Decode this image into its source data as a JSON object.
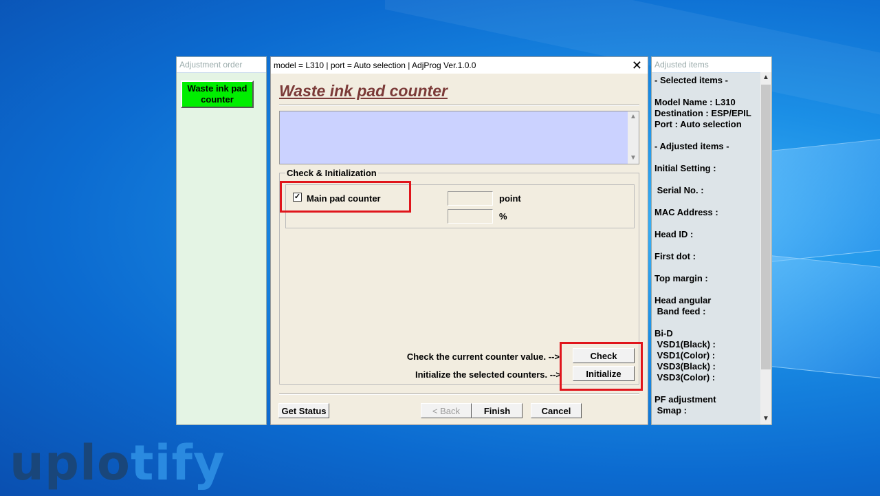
{
  "left_panel": {
    "title": "Adjustment order",
    "green_button": "Waste ink pad counter"
  },
  "main_window": {
    "title": "model = L310 | port = Auto selection | AdjProg Ver.1.0.0",
    "heading": "Waste ink pad counter",
    "group_label": "Check & Initialization",
    "main_pad": {
      "label": "Main pad counter",
      "checked": true,
      "point_value": "",
      "percent_value": "",
      "point_unit": "point",
      "percent_unit": "%"
    },
    "check_prompt": "Check the current counter value. -->",
    "init_prompt": "Initialize the selected counters. -->",
    "check_label": "Check",
    "initialize_label": "Initialize",
    "get_status_label": "Get Status",
    "back_label": "< Back",
    "finish_label": "Finish",
    "cancel_label": "Cancel"
  },
  "right_panel": {
    "title": "Adjusted items",
    "lines": [
      "- Selected items -",
      "",
      "Model Name : L310",
      "Destination : ESP/EPIL",
      "Port : Auto selection",
      "",
      "- Adjusted items -",
      "",
      "Initial Setting :",
      "",
      " Serial No. :",
      "",
      "MAC Address :",
      "",
      "Head ID :",
      "",
      "First dot :",
      "",
      "Top margin :",
      "",
      "Head angular",
      " Band feed :",
      "",
      "Bi-D",
      " VSD1(Black) :",
      " VSD1(Color) :",
      " VSD3(Black) :",
      " VSD3(Color) :",
      "",
      "PF adjustment",
      " Smap :"
    ]
  },
  "watermark": {
    "part1": "uplo",
    "part2": "tify"
  },
  "colors": {
    "highlight_box": "#e0151b",
    "heading": "#7b3a38",
    "green_button": "#00ee00"
  }
}
